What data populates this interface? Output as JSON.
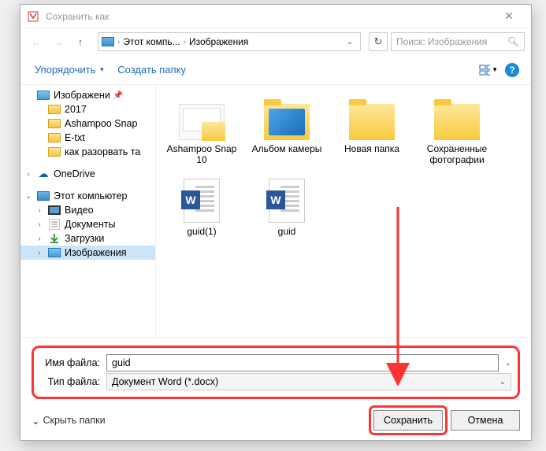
{
  "titlebar": {
    "title": "Сохранить как"
  },
  "nav": {
    "breadcrumb": {
      "seg1": "Этот компь...",
      "seg2": "Изображения"
    },
    "search_placeholder": "Поиск: Изображения"
  },
  "toolbar": {
    "organize": "Упорядочить",
    "newfolder": "Создать папку"
  },
  "sidebar": {
    "items": [
      {
        "label": "Изображени",
        "pinned": true,
        "icon": "pics"
      },
      {
        "label": "2017",
        "icon": "folder",
        "indent": 1
      },
      {
        "label": "Ashampoo Snap",
        "icon": "folder",
        "indent": 1
      },
      {
        "label": "E-txt",
        "icon": "folder",
        "indent": 1
      },
      {
        "label": "как разорвать та",
        "icon": "folder",
        "indent": 1
      },
      {
        "label": "OneDrive",
        "icon": "onedrive",
        "chev": "›"
      },
      {
        "label": "Этот компьютер",
        "icon": "pc",
        "chev": "⌄"
      },
      {
        "label": "Видео",
        "icon": "video",
        "indent": 1,
        "chev": "›"
      },
      {
        "label": "Документы",
        "icon": "docs",
        "indent": 1,
        "chev": "›"
      },
      {
        "label": "Загрузки",
        "icon": "downloads",
        "indent": 1,
        "chev": "›"
      },
      {
        "label": "Изображения",
        "icon": "pics",
        "indent": 1,
        "chev": "›",
        "selected": true
      }
    ]
  },
  "content": {
    "items": [
      {
        "label": "Ashampoo Snap 10",
        "type": "thumb-folder"
      },
      {
        "label": "Альбом камеры",
        "type": "cam-folder"
      },
      {
        "label": "Новая папка",
        "type": "folder"
      },
      {
        "label": "Сохраненные фотографии",
        "type": "folder"
      },
      {
        "label": "guid(1)",
        "type": "word"
      },
      {
        "label": "guid",
        "type": "word"
      }
    ]
  },
  "form": {
    "filename_label": "Имя файла:",
    "filename_value": "guid",
    "filetype_label": "Тип файла:",
    "filetype_value": "Документ Word (*.docx)"
  },
  "buttons": {
    "hide_folders": "Скрыть папки",
    "save": "Сохранить",
    "cancel": "Отмена"
  }
}
